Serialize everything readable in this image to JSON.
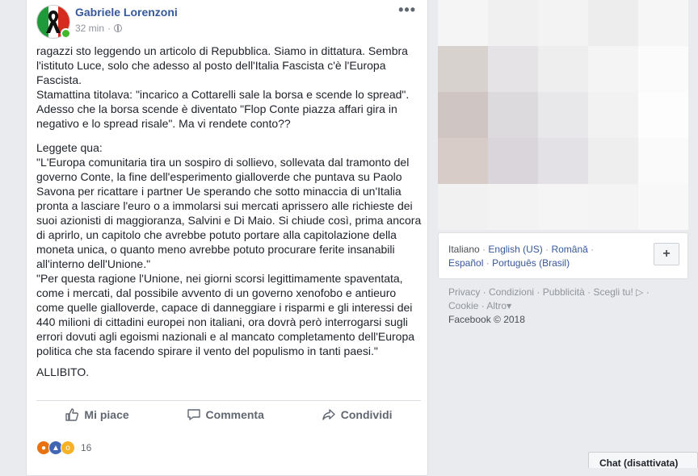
{
  "post": {
    "author": "Gabriele Lorenzoni",
    "time": "32 min",
    "separator": "·",
    "menu_label": "•••",
    "paragraphs": [
      "ragazzi sto leggendo un articolo di Repubblica. Siamo in dittatura. Sembra l'istituto Luce, solo che adesso al posto dell'Italia Fascista c'è l'Europa Fascista.\nStamattina titolava: \"incarico a Cottarelli sale la borsa e scende lo spread\". Adesso che la borsa scende è diventato \"Flop Conte piazza affari gira in negativo e lo spread risale\". Ma vi rendete conto??",
      "Leggete qua:\n\"L'Europa comunitaria tira un sospiro di sollievo, sollevata dal tramonto del governo Conte, la fine dell'esperimento gialloverde che puntava su Paolo Savona per ricattare i partner Ue sperando che sotto minaccia di un'Italia pronta a lasciare l'euro o a immolarsi sui mercati aprissero alle richieste dei suoi azionisti di maggioranza, Salvini e Di Maio. Si chiude così, prima ancora di aprirlo, un capitolo che avrebbe potuto portare alla capitolazione della moneta unica, o quanto meno avrebbe potuto procurare ferite insanabili all'interno dell'Unione.\"\n\"Per questa ragione l'Unione, nei giorni scorsi legittimamente spaventata, come i mercati, dal possibile avvento di un governo xenofobo e antieuro come quelle gialloverde, capace di danneggiare i risparmi e gli interessi dei 440 milioni di cittadini europei non italiani, ora dovrà però interrogarsi sugli errori dovuti agli egoismi nazionali e al mancato completamento dell'Europa politica che sta facendo spirare il vento del populismo in tanti paesi.\"",
      "ALLIBITO."
    ],
    "actions": {
      "like": "Mi piace",
      "comment": "Commenta",
      "share": "Condividi"
    },
    "reaction_count": "16"
  },
  "sidebar": {
    "languages": {
      "current": "Italiano",
      "list": [
        "English (US)",
        "Română",
        "Español",
        "Português (Brasil)"
      ],
      "sep": "·",
      "add": "+"
    },
    "footer": {
      "links": [
        "Privacy",
        "Condizioni",
        "Pubblicità",
        "Scegli tu!",
        "Cookie",
        "Altro"
      ],
      "more_arrow": "▾",
      "adchoices": "▷",
      "copyright": "Facebook © 2018"
    }
  },
  "chat": {
    "label": "Chat (disattivata)"
  },
  "colors": {
    "link": "#365899",
    "background": "#e9ebee",
    "online": "#42b72a"
  }
}
